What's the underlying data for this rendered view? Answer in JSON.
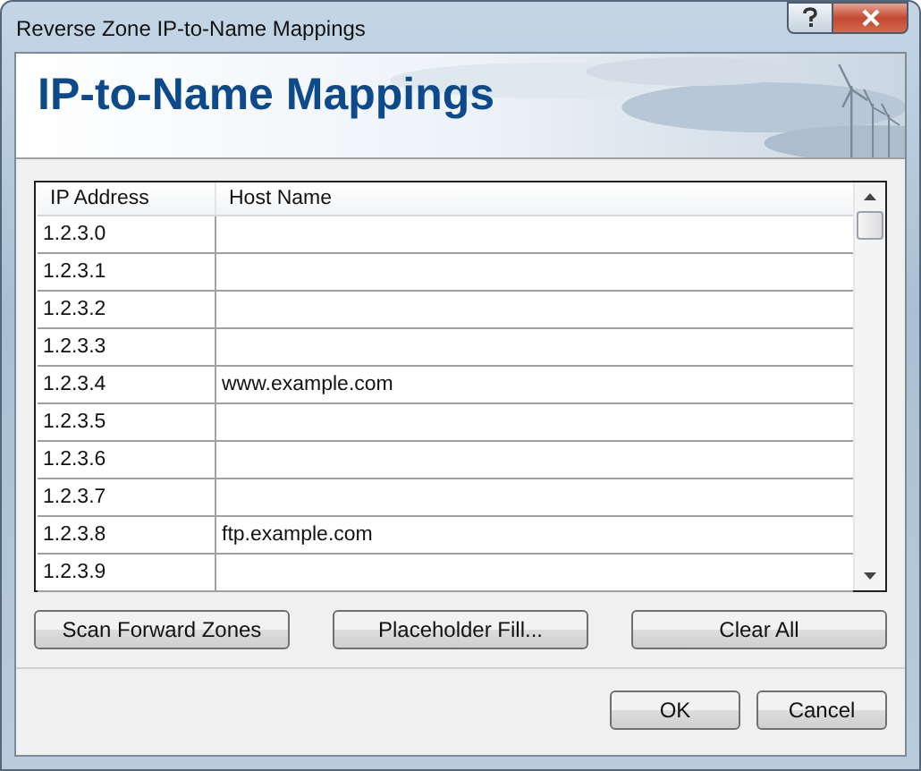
{
  "window": {
    "title": "Reverse Zone IP-to-Name Mappings"
  },
  "header": {
    "title": "IP-to-Name Mappings"
  },
  "table": {
    "columns": [
      "IP Address",
      "Host Name"
    ],
    "rows": [
      {
        "ip_address": "1.2.3.0"
      },
      {
        "ip_address": "1.2.3.1"
      },
      {
        "ip_address": "1.2.3.2"
      },
      {
        "ip_address": "1.2.3.3"
      },
      {
        "ip_address": "1.2.3.4",
        "host_name": "www.example.com"
      },
      {
        "ip_address": "1.2.3.5"
      },
      {
        "ip_address": "1.2.3.6"
      },
      {
        "ip_address": "1.2.3.7"
      },
      {
        "ip_address": "1.2.3.8",
        "host_name": "ftp.example.com"
      },
      {
        "ip_address": "1.2.3.9"
      }
    ]
  },
  "actions": [
    "Scan Forward Zones",
    "Placeholder Fill...",
    "Clear All"
  ],
  "dialog_buttons": [
    "OK",
    "Cancel"
  ]
}
